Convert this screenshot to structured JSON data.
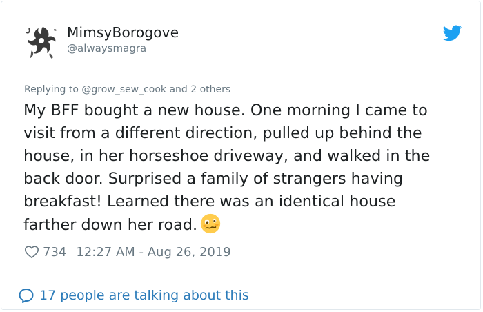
{
  "tweet": {
    "display_name": "MimsyBorogove",
    "handle": "@alwaysmagra",
    "replying_to": "Replying to @grow_sew_cook and 2 others",
    "text": "My BFF bought a new house. One morning I came to\nvisit from a different direction, pulled up behind the\nhouse, in her horseshoe driveway, and walked in the\nback door. Surprised a family of strangers having\nbreakfast! Learned there was an identical house\nfarther down her road.",
    "emoji": "woozy-face",
    "likes": "734",
    "timestamp": "12:27 AM - Aug 26, 2019"
  },
  "footer": {
    "talking": "17 people are talking about this"
  },
  "colors": {
    "twitter_blue": "#1da1f2",
    "link_blue": "#2b7bb9",
    "secondary_text": "#697882",
    "border": "#e1e8ed"
  }
}
